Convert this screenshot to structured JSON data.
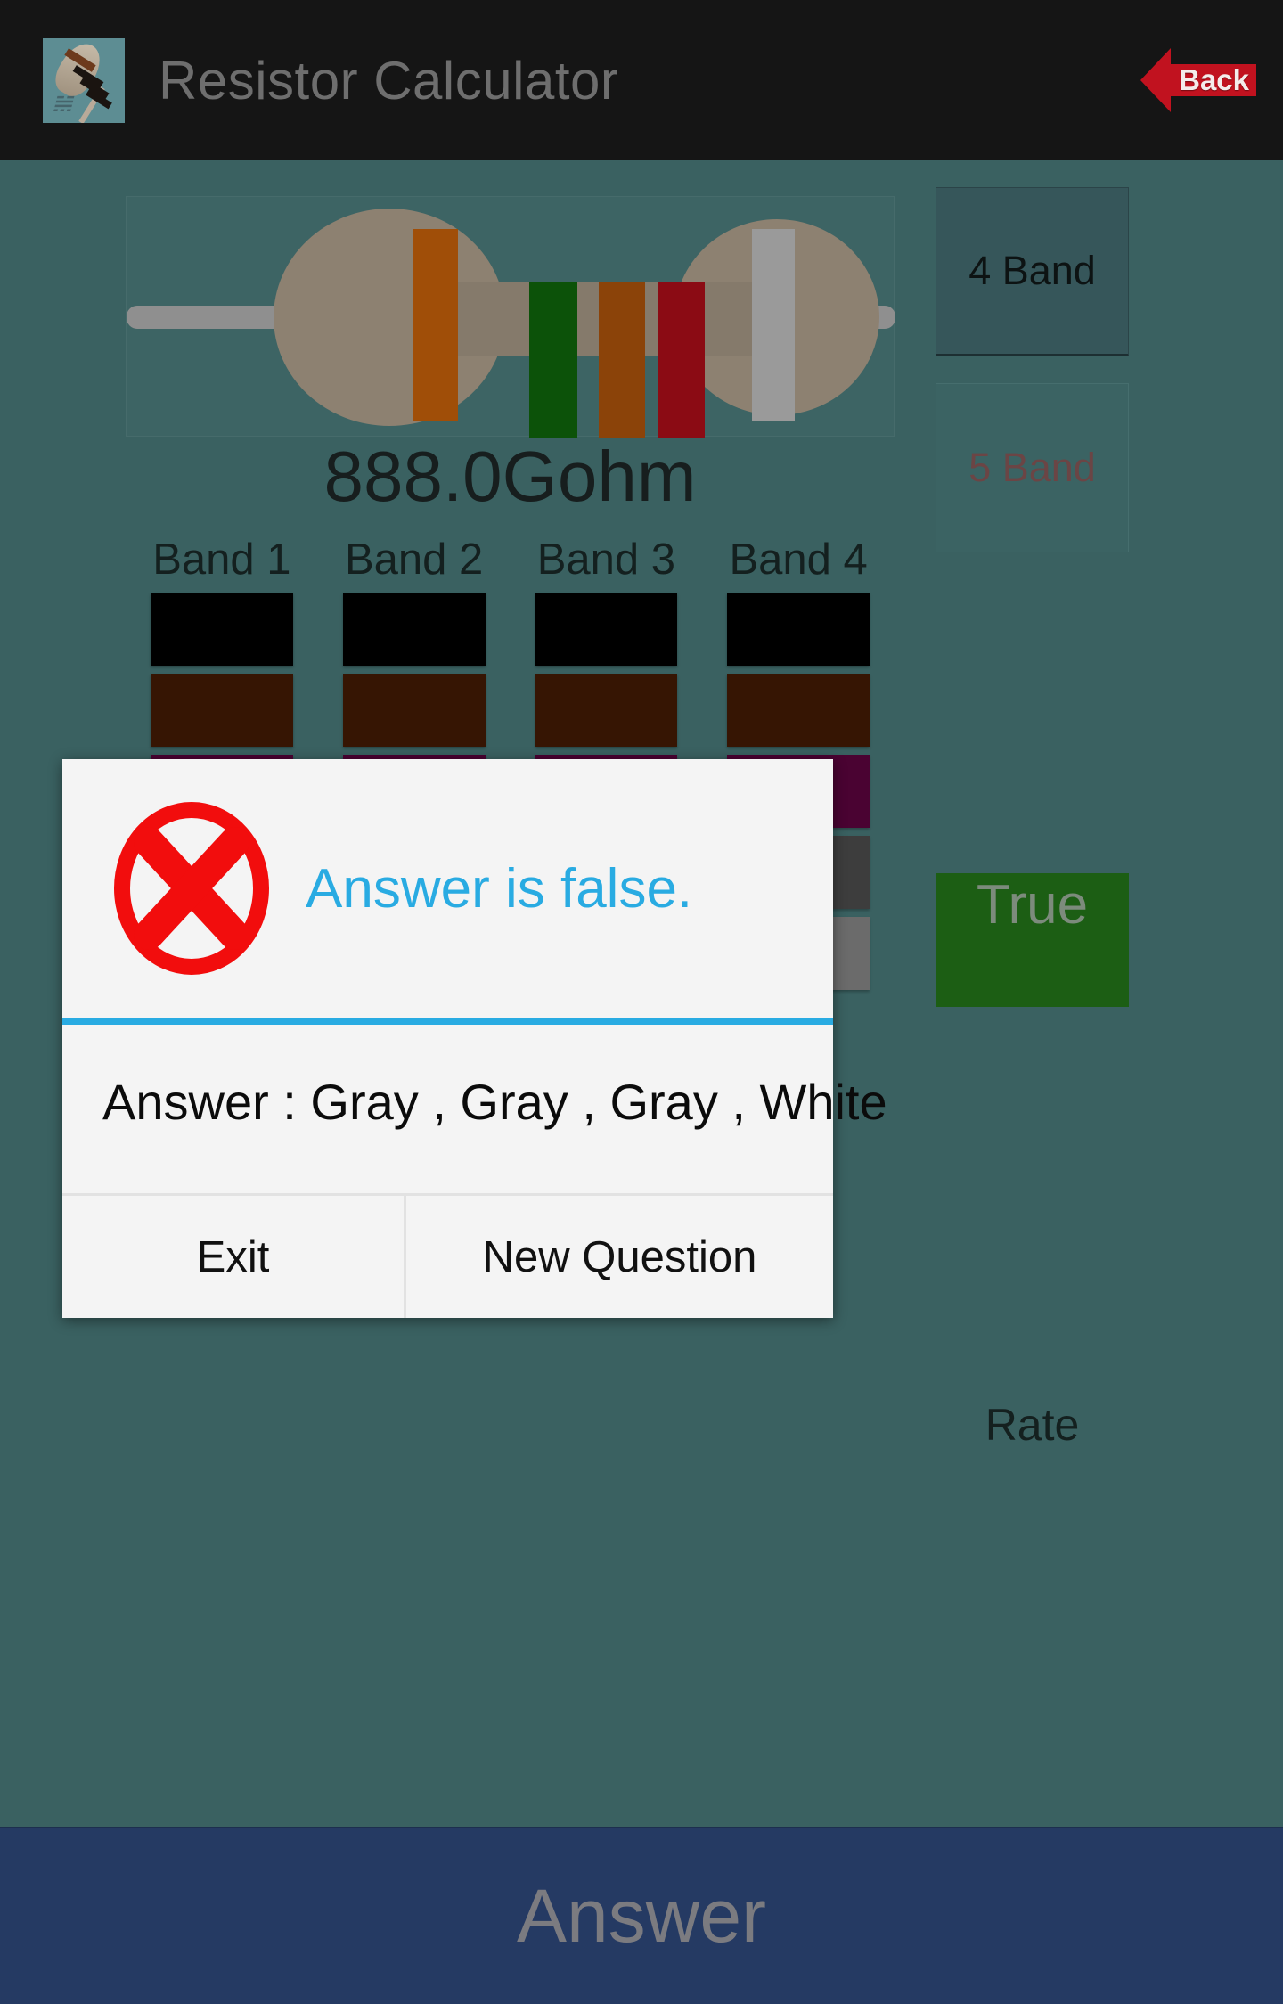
{
  "titlebar": {
    "app_icon": "resistor-app-icon",
    "title": "Resistor Calculator",
    "back_label": "Back",
    "back_icon": "back-arrow-icon",
    "background_color": "#151515",
    "title_color": "#6e6e6e",
    "back_arrow_color": "#c1121f"
  },
  "main": {
    "background_color": "#3a6161",
    "resistance_value": "888.0Gohm",
    "resistor": {
      "body_color": "#8d8171",
      "lead_color": "#8f8f8f",
      "bands": [
        {
          "name": "band-1",
          "color": "#a04e08"
        },
        {
          "name": "band-2",
          "color": "#0c5209"
        },
        {
          "name": "band-3",
          "color": "#8b4309"
        },
        {
          "name": "band-4",
          "color": "#8b0b14"
        },
        {
          "name": "tolerance-band",
          "color": "#9a9a9a"
        }
      ]
    },
    "band_labels": [
      "Band 1",
      "Band 2",
      "Band 3",
      "Band 4"
    ],
    "swatch_rows": [
      {
        "name": "black",
        "color": "#000000"
      },
      {
        "name": "brown",
        "color": "#361503"
      },
      {
        "name": "violet",
        "color": "#4a0332"
      },
      {
        "name": "gray-dark",
        "color": "#3d3d3d"
      },
      {
        "name": "gray",
        "color": "#6b6b6b"
      }
    ],
    "mode_buttons": [
      {
        "label": "4 Band",
        "state": "selected"
      },
      {
        "label": "5 Band",
        "state": "disabled"
      }
    ],
    "true_button_label": "True",
    "rate_label": "Rate"
  },
  "dialog": {
    "icon": "red-circle-x-icon",
    "icon_color": "#f20d0d",
    "title": "Answer is false.",
    "title_color": "#29abe2",
    "accent_color": "#29abe2",
    "answer_line": "Answer : Gray , Gray , Gray , White",
    "buttons": [
      {
        "label": "Exit",
        "name": "exit-button"
      },
      {
        "label": "New Question",
        "name": "new-question-button"
      }
    ]
  },
  "bottom_bar": {
    "label": "Answer",
    "background_color": "#253a63",
    "text_color": "#7b7b80"
  }
}
